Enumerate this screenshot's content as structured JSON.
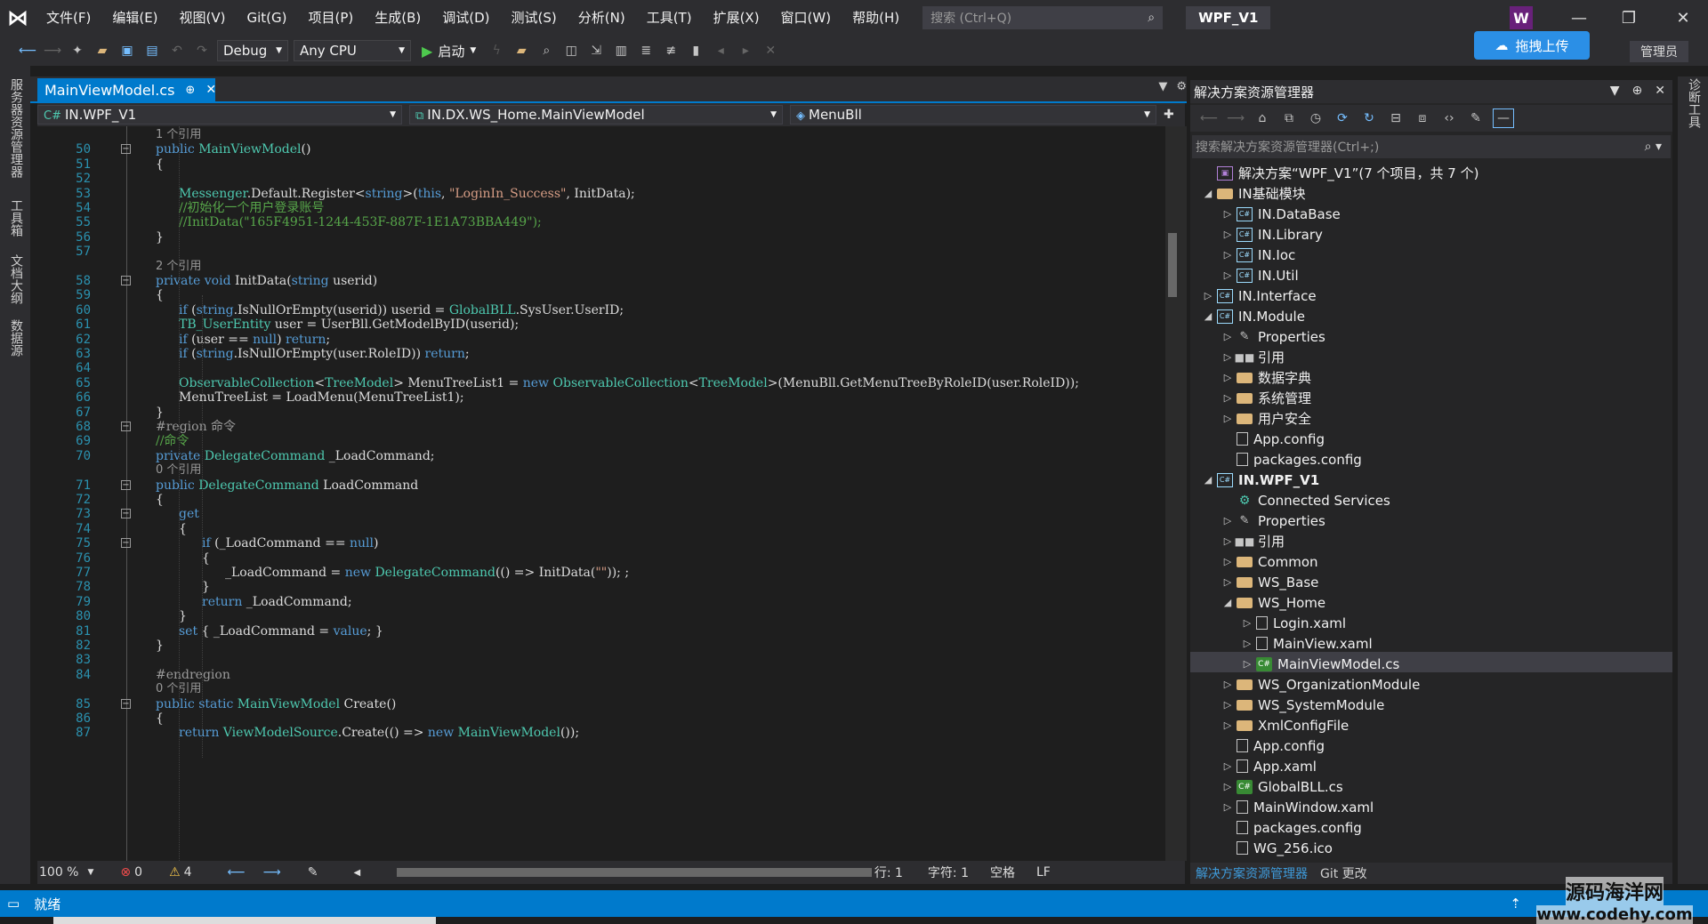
{
  "titlebar": {
    "menus": [
      "文件(F)",
      "编辑(E)",
      "视图(V)",
      "Git(G)",
      "项目(P)",
      "生成(B)",
      "调试(D)",
      "测试(S)",
      "分析(N)",
      "工具(T)",
      "扩展(X)",
      "窗口(W)",
      "帮助(H)"
    ],
    "search_placeholder": "搜索 (Ctrl+Q)",
    "solution_name": "WPF_V1",
    "user_initial": "W"
  },
  "toolbar": {
    "config": "Debug",
    "platform": "Any CPU",
    "start_label": "启动",
    "upload_label": "拖拽上传",
    "admin_label": "管理员"
  },
  "left_strip": [
    "服务器资源管理器",
    "工具箱",
    "文档大纲",
    "数据源"
  ],
  "right_strip": [
    "诊断工具"
  ],
  "editor": {
    "tab_label": "MainViewModel.cs",
    "nav_project": "IN.WPF_V1",
    "nav_class": "IN.DX.WS_Home.MainViewModel",
    "nav_member": "MenuBll",
    "lines": [
      {
        "n": "",
        "lens": "1 个引用",
        "indent": 0
      },
      {
        "n": "50",
        "code": "public MainViewModel()",
        "indent": 0
      },
      {
        "n": "51",
        "code": "{",
        "indent": 0
      },
      {
        "n": "52",
        "code": "",
        "indent": 1
      },
      {
        "n": "53",
        "code": "Messenger.Default.Register<string>(this, \"LoginIn_Success\", InitData);",
        "indent": 1
      },
      {
        "n": "54",
        "code": "//初始化一个用户登录账号",
        "indent": 1
      },
      {
        "n": "55",
        "code": "//InitData(\"165F4951-1244-453F-887F-1E1A73BBA449\");",
        "indent": 1
      },
      {
        "n": "56",
        "code": "}",
        "indent": 0
      },
      {
        "n": "57",
        "code": "",
        "indent": 0
      },
      {
        "n": "",
        "lens": "2 个引用",
        "indent": 0
      },
      {
        "n": "58",
        "code": "private void InitData(string userid)",
        "indent": 0
      },
      {
        "n": "59",
        "code": "{",
        "indent": 0
      },
      {
        "n": "60",
        "code": "if (string.IsNullOrEmpty(userid)) userid = GlobalBLL.SysUser.UserID;",
        "indent": 1
      },
      {
        "n": "61",
        "code": "TB_UserEntity user = UserBll.GetModelByID(userid);",
        "indent": 1
      },
      {
        "n": "62",
        "code": "if (user == null) return;",
        "indent": 1
      },
      {
        "n": "63",
        "code": "if (string.IsNullOrEmpty(user.RoleID)) return;",
        "indent": 1
      },
      {
        "n": "64",
        "code": "",
        "indent": 1
      },
      {
        "n": "65",
        "code": "ObservableCollection<TreeModel> MenuTreeList1 = new ObservableCollection<TreeModel>(MenuBll.GetMenuTreeByRoleID(user.RoleID));",
        "indent": 1
      },
      {
        "n": "66",
        "code": "MenuTreeList = LoadMenu(MenuTreeList1);",
        "indent": 1
      },
      {
        "n": "67",
        "code": "}",
        "indent": 0
      },
      {
        "n": "68",
        "code": "#region 命令",
        "indent": 0
      },
      {
        "n": "69",
        "code": "//命令",
        "indent": 0
      },
      {
        "n": "70",
        "code": "private DelegateCommand _LoadCommand;",
        "indent": 0
      },
      {
        "n": "",
        "lens": "0 个引用",
        "indent": 0
      },
      {
        "n": "71",
        "code": "public DelegateCommand LoadCommand",
        "indent": 0
      },
      {
        "n": "72",
        "code": "{",
        "indent": 0
      },
      {
        "n": "73",
        "code": "get",
        "indent": 1
      },
      {
        "n": "74",
        "code": "{",
        "indent": 1
      },
      {
        "n": "75",
        "code": "if (_LoadCommand == null)",
        "indent": 2
      },
      {
        "n": "76",
        "code": "{",
        "indent": 2
      },
      {
        "n": "77",
        "code": "_LoadCommand = new DelegateCommand(() => InitData(\"\")); ;",
        "indent": 3
      },
      {
        "n": "78",
        "code": "}",
        "indent": 2
      },
      {
        "n": "79",
        "code": "return _LoadCommand;",
        "indent": 2
      },
      {
        "n": "80",
        "code": "}",
        "indent": 1
      },
      {
        "n": "81",
        "code": "set { _LoadCommand = value; }",
        "indent": 1
      },
      {
        "n": "82",
        "code": "}",
        "indent": 0
      },
      {
        "n": "83",
        "code": "",
        "indent": 0
      },
      {
        "n": "84",
        "code": "#endregion",
        "indent": 0
      },
      {
        "n": "",
        "lens": "0 个引用",
        "indent": 0
      },
      {
        "n": "85",
        "code": "public static MainViewModel Create()",
        "indent": 0
      },
      {
        "n": "86",
        "code": "{",
        "indent": 0
      },
      {
        "n": "87",
        "code": "return ViewModelSource.Create(() => new MainViewModel());",
        "indent": 1
      }
    ]
  },
  "editor_status": {
    "zoom": "100 %",
    "errors": "0",
    "warnings": "4",
    "line": "行: 1",
    "col": "字符: 1",
    "spacing": "空格",
    "eol": "LF"
  },
  "solution_explorer": {
    "title": "解决方案资源管理器",
    "search_placeholder": "搜索解决方案资源管理器(Ctrl+;)",
    "items": [
      {
        "level": 0,
        "arrow": "",
        "icon": "sln",
        "label": "解决方案“WPF_V1”(7 个项目，共 7 个)"
      },
      {
        "level": 0,
        "arrow": "◢",
        "icon": "folder",
        "label": "IN基础模块"
      },
      {
        "level": 1,
        "arrow": "▷",
        "icon": "proj",
        "label": "IN.DataBase"
      },
      {
        "level": 1,
        "arrow": "▷",
        "icon": "proj",
        "label": "IN.Library"
      },
      {
        "level": 1,
        "arrow": "▷",
        "icon": "proj",
        "label": "IN.Ioc"
      },
      {
        "level": 1,
        "arrow": "▷",
        "icon": "proj",
        "label": "IN.Util"
      },
      {
        "level": 0,
        "arrow": "▷",
        "icon": "proj",
        "label": "IN.Interface"
      },
      {
        "level": 0,
        "arrow": "◢",
        "icon": "proj",
        "label": "IN.Module"
      },
      {
        "level": 1,
        "arrow": "▷",
        "icon": "wrench",
        "label": "Properties"
      },
      {
        "level": 1,
        "arrow": "▷",
        "icon": "ref",
        "label": "引用"
      },
      {
        "level": 1,
        "arrow": "▷",
        "icon": "folder",
        "label": "数据字典"
      },
      {
        "level": 1,
        "arrow": "▷",
        "icon": "folder",
        "label": "系统管理"
      },
      {
        "level": 1,
        "arrow": "▷",
        "icon": "folder",
        "label": "用户安全"
      },
      {
        "level": 1,
        "arrow": "",
        "icon": "file",
        "label": "App.config"
      },
      {
        "level": 1,
        "arrow": "",
        "icon": "file",
        "label": "packages.config"
      },
      {
        "level": 0,
        "arrow": "◢",
        "icon": "proj",
        "label": "IN.WPF_V1",
        "bold": true
      },
      {
        "level": 1,
        "arrow": "",
        "icon": "globe",
        "label": "Connected Services"
      },
      {
        "level": 1,
        "arrow": "▷",
        "icon": "wrench",
        "label": "Properties"
      },
      {
        "level": 1,
        "arrow": "▷",
        "icon": "ref",
        "label": "引用"
      },
      {
        "level": 1,
        "arrow": "▷",
        "icon": "folder",
        "label": "Common"
      },
      {
        "level": 1,
        "arrow": "▷",
        "icon": "folder",
        "label": "WS_Base"
      },
      {
        "level": 1,
        "arrow": "◢",
        "icon": "folder",
        "label": "WS_Home"
      },
      {
        "level": 2,
        "arrow": "▷",
        "icon": "file",
        "label": "Login.xaml"
      },
      {
        "level": 2,
        "arrow": "▷",
        "icon": "file",
        "label": "MainView.xaml"
      },
      {
        "level": 2,
        "arrow": "▷",
        "icon": "cs",
        "label": "MainViewModel.cs",
        "selected": true
      },
      {
        "level": 1,
        "arrow": "▷",
        "icon": "folder",
        "label": "WS_OrganizationModule"
      },
      {
        "level": 1,
        "arrow": "▷",
        "icon": "folder",
        "label": "WS_SystemModule"
      },
      {
        "level": 1,
        "arrow": "▷",
        "icon": "folder",
        "label": "XmlConfigFile"
      },
      {
        "level": 1,
        "arrow": "",
        "icon": "file",
        "label": "App.config"
      },
      {
        "level": 1,
        "arrow": "▷",
        "icon": "file",
        "label": "App.xaml"
      },
      {
        "level": 1,
        "arrow": "▷",
        "icon": "cs",
        "label": "GlobalBLL.cs"
      },
      {
        "level": 1,
        "arrow": "▷",
        "icon": "file",
        "label": "MainWindow.xaml"
      },
      {
        "level": 1,
        "arrow": "",
        "icon": "file",
        "label": "packages.config"
      },
      {
        "level": 1,
        "arrow": "",
        "icon": "file",
        "label": "WG_256.ico"
      }
    ],
    "bottom_tabs": [
      "解决方案资源管理器",
      "Git 更改"
    ]
  },
  "statusbar": {
    "ready": "就绪"
  },
  "watermark": {
    "title": "源码海洋网",
    "url": "www.codehy.com"
  },
  "colors": {
    "accent": "#007acc",
    "keyword": "#569cd6",
    "type": "#4ec9b0",
    "string": "#d69d85",
    "comment": "#57a64a"
  }
}
